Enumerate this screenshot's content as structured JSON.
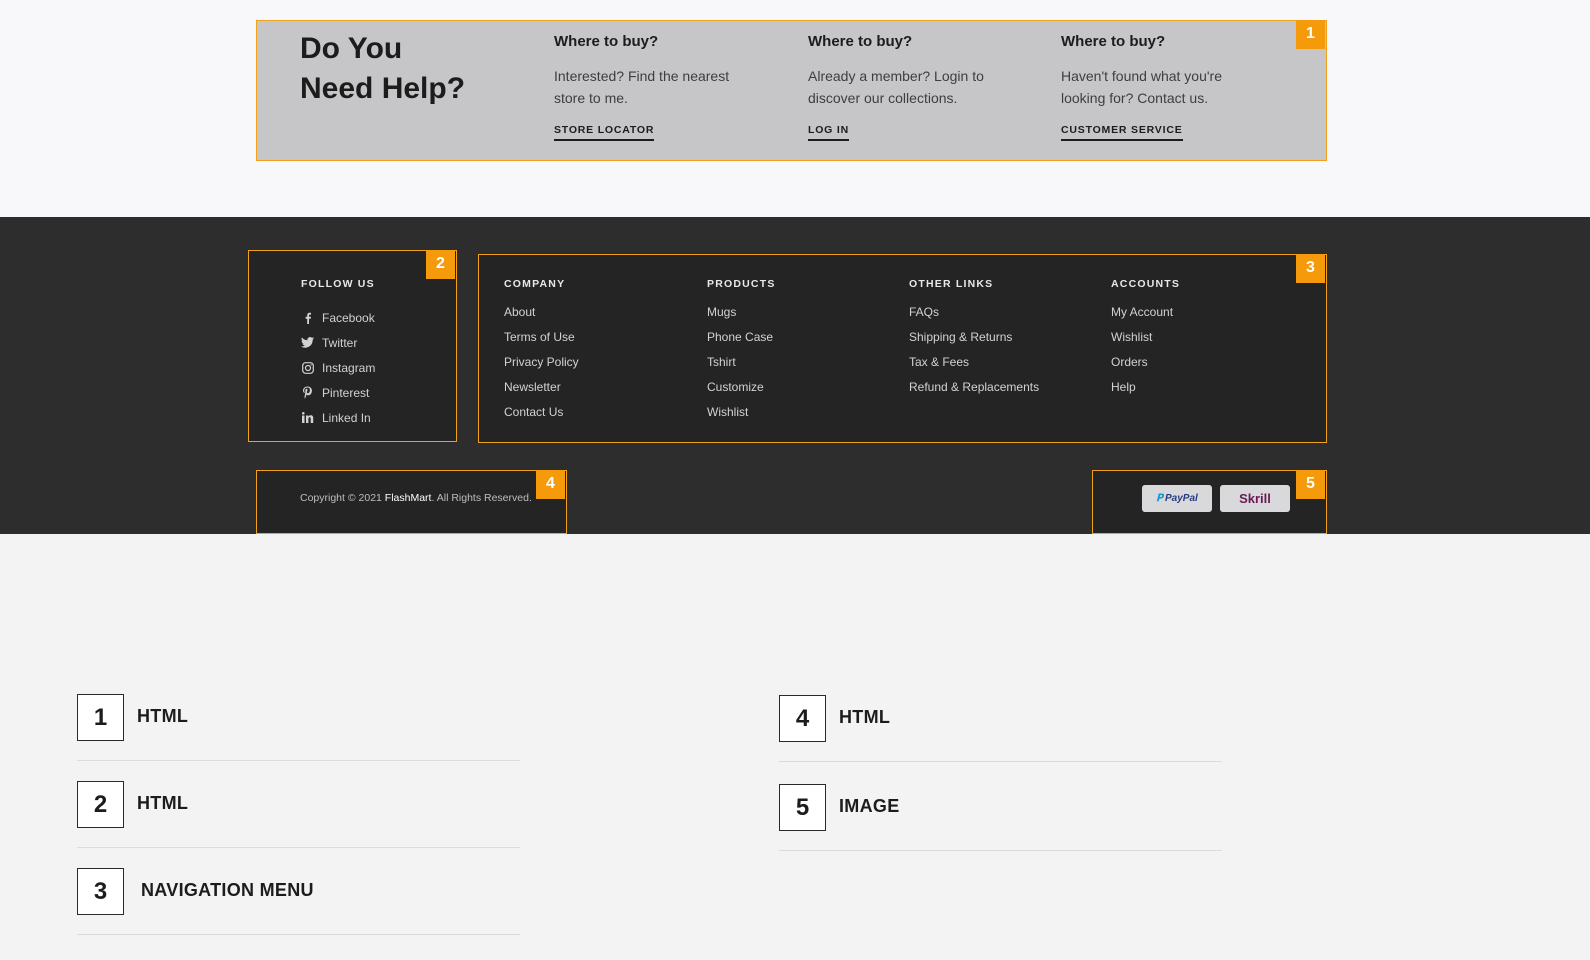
{
  "help": {
    "title_line1": "Do You",
    "title_line2": "Need Help?",
    "columns": [
      {
        "heading": "Where to buy?",
        "text_line1": "Interested? Find the nearest",
        "text_line2": "store to me.",
        "link": "STORE LOCATOR"
      },
      {
        "heading": "Where to buy?",
        "text_line1": "Already a member? Login to",
        "text_line2": "discover our collections.",
        "link": "LOG IN"
      },
      {
        "heading": "Where to buy?",
        "text_line1": "Haven't found what you're",
        "text_line2": "looking for? Contact us.",
        "link": "CUSTOMER SERVICE"
      }
    ]
  },
  "markers": [
    "1",
    "2",
    "3",
    "4",
    "5"
  ],
  "follow": {
    "heading": "FOLLOW US",
    "items": [
      {
        "label": "Facebook",
        "icon": "facebook-icon"
      },
      {
        "label": "Twitter",
        "icon": "twitter-icon"
      },
      {
        "label": "Instagram",
        "icon": "instagram-icon"
      },
      {
        "label": "Pinterest",
        "icon": "pinterest-icon"
      },
      {
        "label": "Linked In",
        "icon": "linkedin-icon"
      }
    ]
  },
  "nav": {
    "company": {
      "heading": "COMPANY",
      "links": [
        "About",
        "Terms of Use",
        "Privacy Policy",
        "Newsletter",
        "Contact Us"
      ]
    },
    "products": {
      "heading": "PRODUCTS",
      "links": [
        "Mugs",
        "Phone Case",
        "Tshirt",
        "Customize",
        "Wishlist"
      ]
    },
    "other": {
      "heading": "OTHER LINKS",
      "links": [
        "FAQs",
        "Shipping & Returns",
        "Tax & Fees",
        "Refund & Replacements"
      ]
    },
    "accounts": {
      "heading": "ACCOUNTS",
      "links": [
        "My Account",
        "Wishlist",
        "Orders",
        "Help"
      ]
    }
  },
  "copyright": {
    "prefix": "Copyright © 2021 ",
    "brand": "FlashMart",
    "suffix": ". All Rights Reserved."
  },
  "payments": [
    {
      "label": "PayPal",
      "icon": "paypal-logo",
      "color": "#253b80"
    },
    {
      "label": "Skrill",
      "icon": "skrill-logo",
      "color": "#6b1a57"
    }
  ],
  "legend": [
    {
      "num": "1",
      "label": "HTML"
    },
    {
      "num": "2",
      "label": "HTML"
    },
    {
      "num": "3",
      "label": "NAVIGATION MENU"
    },
    {
      "num": "4",
      "label": "HTML"
    },
    {
      "num": "5",
      "label": "IMAGE"
    }
  ],
  "colors": {
    "accent": "#f59a0a",
    "footer_bg": "#2d2d2d",
    "help_bg": "#c6c6c8"
  }
}
